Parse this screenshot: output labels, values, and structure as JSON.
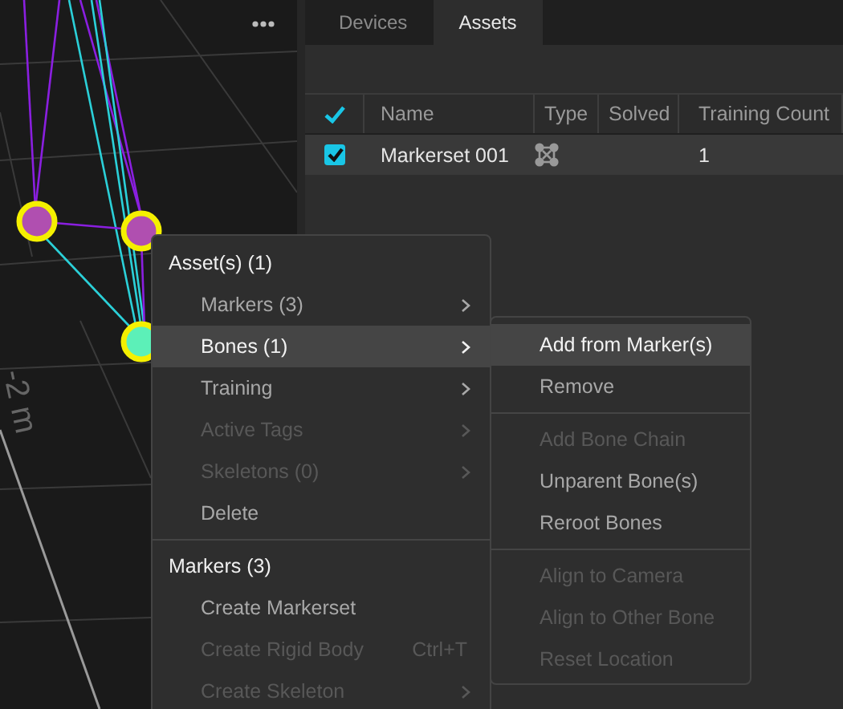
{
  "viewport": {
    "axis_label": "-2 m"
  },
  "tabs": [
    {
      "label": "Devices",
      "selected": false
    },
    {
      "label": "Assets",
      "selected": true
    }
  ],
  "table": {
    "header_checked": true,
    "columns": [
      "Name",
      "Type",
      "Solved",
      "Training Count"
    ],
    "rows": [
      {
        "checked": true,
        "selected": true,
        "name": "Markerset 001",
        "training_count": "1"
      }
    ]
  },
  "context_menu": {
    "sections": [
      {
        "heading": "Asset(s) (1)",
        "items": [
          {
            "label": "Markers (3)",
            "disabled": false,
            "selected": false,
            "submenu": true
          },
          {
            "label": "Bones (1)",
            "disabled": false,
            "selected": true,
            "submenu": true
          },
          {
            "label": "Training",
            "disabled": false,
            "selected": false,
            "submenu": true
          },
          {
            "label": "Active Tags",
            "disabled": true,
            "selected": false,
            "submenu": true
          },
          {
            "label": "Skeletons (0)",
            "disabled": true,
            "selected": false,
            "submenu": true
          },
          {
            "label": "Delete",
            "disabled": false,
            "selected": false,
            "submenu": false
          }
        ]
      },
      {
        "heading": "Markers (3)",
        "items": [
          {
            "label": "Create Markerset",
            "disabled": false,
            "selected": false,
            "submenu": false
          },
          {
            "label": "Create Rigid Body",
            "disabled": true,
            "selected": false,
            "submenu": false,
            "shortcut": "Ctrl+T"
          },
          {
            "label": "Create Skeleton",
            "disabled": true,
            "selected": false,
            "submenu": true
          }
        ]
      }
    ]
  },
  "submenu": {
    "groups": [
      [
        {
          "label": "Add from Marker(s)",
          "disabled": false,
          "selected": true
        },
        {
          "label": "Remove",
          "disabled": false,
          "selected": false
        }
      ],
      [
        {
          "label": "Add Bone Chain",
          "disabled": true,
          "selected": false
        },
        {
          "label": "Unparent Bone(s)",
          "disabled": false,
          "selected": false
        },
        {
          "label": "Reroot Bones",
          "disabled": false,
          "selected": false
        }
      ],
      [
        {
          "label": "Align to Camera",
          "disabled": true,
          "selected": false
        },
        {
          "label": "Align to Other Bone",
          "disabled": true,
          "selected": false
        },
        {
          "label": "Reset Location",
          "disabled": true,
          "selected": false
        }
      ]
    ]
  }
}
